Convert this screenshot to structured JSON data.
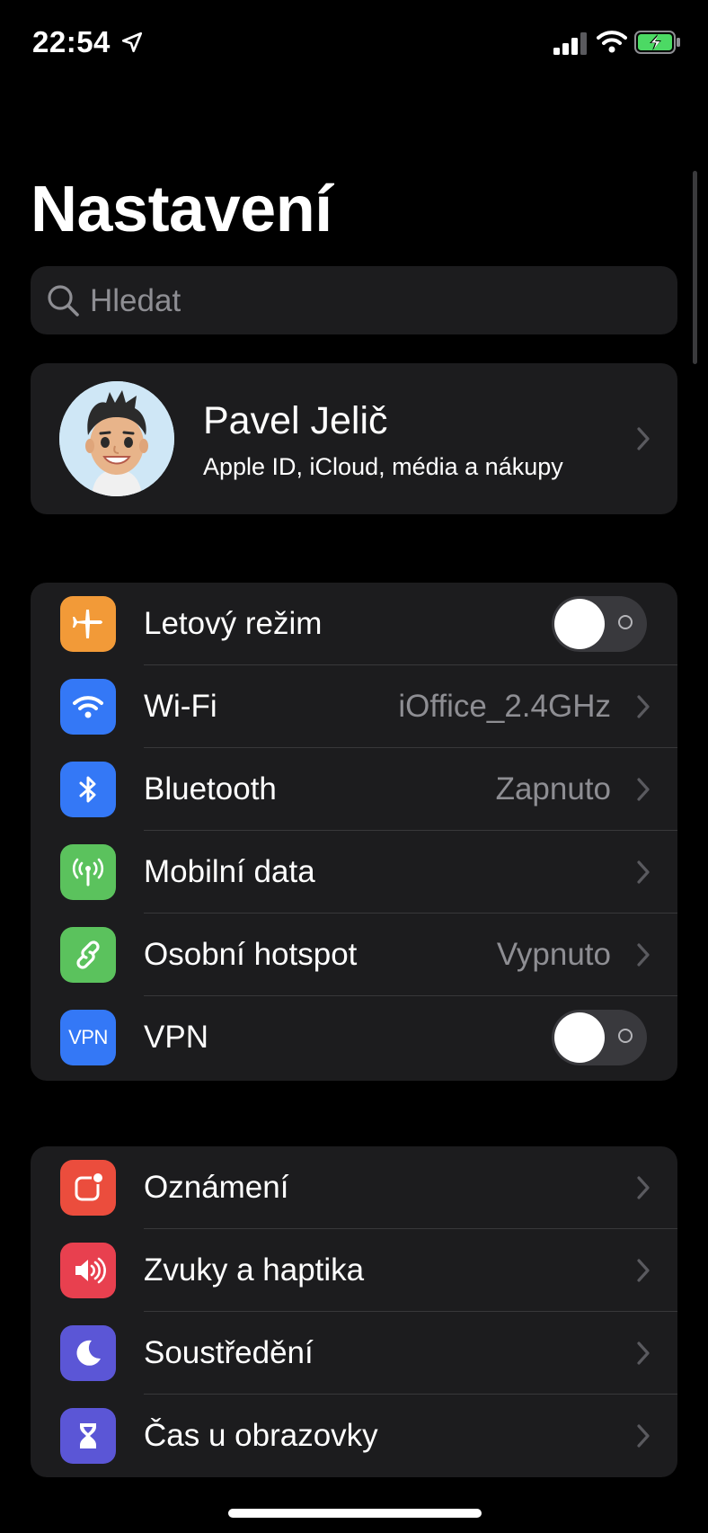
{
  "status_bar": {
    "time": "22:54",
    "icons": [
      "location-arrow-icon",
      "cellular-signal-icon",
      "wifi-icon",
      "battery-charging-icon"
    ],
    "battery_color": "#4cd964"
  },
  "header": {
    "title": "Nastavení"
  },
  "search": {
    "placeholder": "Hledat"
  },
  "profile": {
    "name": "Pavel Jelič",
    "subtitle": "Apple ID, iCloud, média a nákupy",
    "avatar": "memoji-avatar"
  },
  "connectivity": {
    "items": [
      {
        "label": "Letový režim",
        "icon": "airplane-icon",
        "color": "#f29a38",
        "toggle": false
      },
      {
        "label": "Wi-Fi",
        "icon": "wifi-icon",
        "color": "#3478f6",
        "value": "iOffice_2.4GHz"
      },
      {
        "label": "Bluetooth",
        "icon": "bluetooth-icon",
        "color": "#3478f6",
        "value": "Zapnuto"
      },
      {
        "label": "Mobilní data",
        "icon": "antenna-icon",
        "color": "#5bc25d"
      },
      {
        "label": "Osobní hotspot",
        "icon": "hotspot-icon",
        "color": "#5bc25d",
        "value": "Vypnuto"
      },
      {
        "label": "VPN",
        "icon": "vpn-icon",
        "icon_text": "VPN",
        "color": "#3478f6",
        "toggle": false
      }
    ]
  },
  "notifications": {
    "items": [
      {
        "label": "Oznámení",
        "icon": "notifications-icon",
        "color": "#eb4d3d"
      },
      {
        "label": "Zvuky a haptika",
        "icon": "speaker-icon",
        "color": "#e8404f"
      },
      {
        "label": "Soustředění",
        "icon": "moon-icon",
        "color": "#5b56d6"
      },
      {
        "label": "Čas u obrazovky",
        "icon": "hourglass-icon",
        "color": "#5b56d6"
      }
    ]
  }
}
